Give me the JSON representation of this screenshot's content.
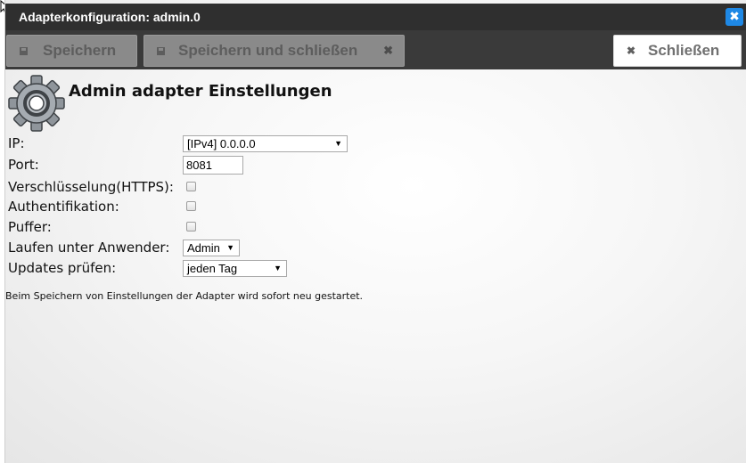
{
  "window": {
    "title": "Adapterkonfiguration: admin.0",
    "close_glyph": "✖",
    "accent": "#1e88e5"
  },
  "toolbar": {
    "save_label": "Speichern",
    "save_close_label": "Speichern und schließen",
    "save_close_x": "✖",
    "close_label": "Schließen",
    "close_x": "✖"
  },
  "settings": {
    "heading": "Admin adapter Einstellungen",
    "icon": "gear-icon",
    "ip_label": "IP:",
    "ip_value": "[IPv4] 0.0.0.0",
    "port_label": "Port:",
    "port_value": "8081",
    "https_label": "Verschlüsselung(HTTPS):",
    "https_checked": false,
    "auth_label": "Authentifikation:",
    "auth_checked": false,
    "cache_label": "Puffer:",
    "cache_checked": false,
    "user_label": "Laufen unter Anwender:",
    "user_value": "Admin",
    "updates_label": "Updates prüfen:",
    "updates_value": "jeden Tag",
    "dropdown_arrow": "▼"
  },
  "note": "Beim Speichern von Einstellungen der Adapter wird sofort neu gestartet."
}
